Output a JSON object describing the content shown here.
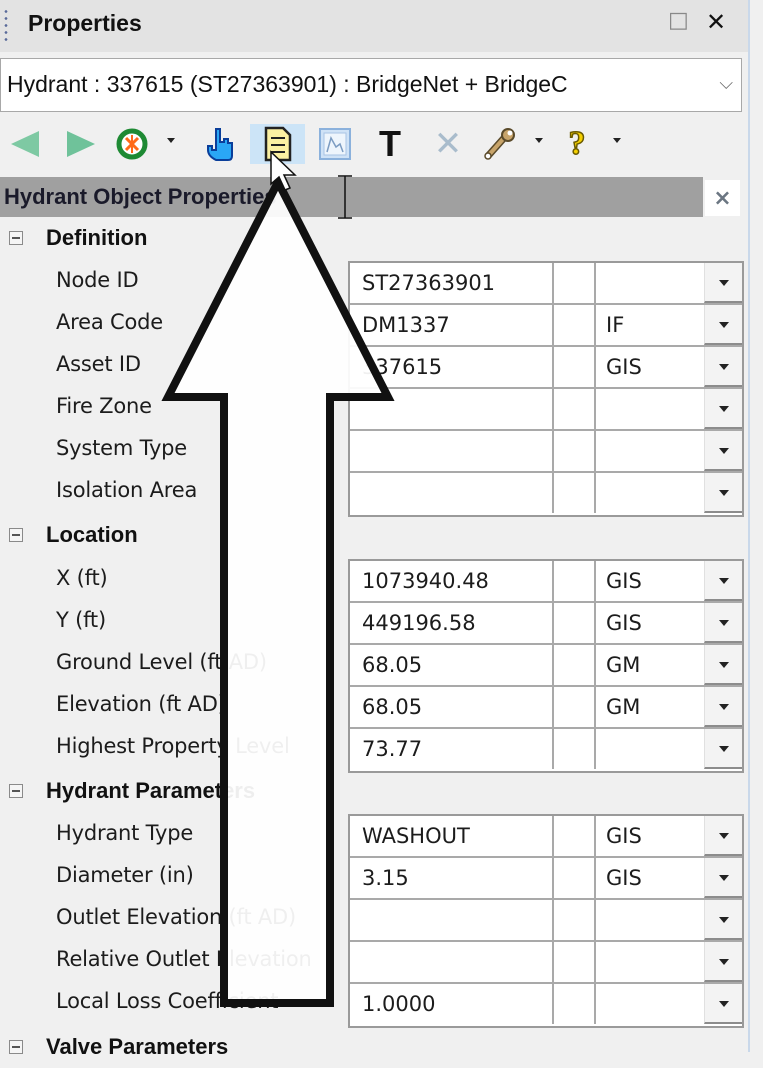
{
  "panel": {
    "title": "Properties",
    "restore_icon": "□",
    "close_icon": "✕"
  },
  "selector": {
    "value": "Hydrant : 337615 (ST27363901) : BridgeNet + BridgeC",
    "chevron": "⌵"
  },
  "toolbar": {
    "items": [
      {
        "name": "back",
        "icon": "back-arrow-icon"
      },
      {
        "name": "forward",
        "icon": "forward-arrow-icon"
      },
      {
        "name": "locate",
        "icon": "target-icon",
        "dropdown": true
      },
      {
        "name": "select",
        "icon": "pointing-hand-icon"
      },
      {
        "name": "properties",
        "icon": "notes-document-icon",
        "active": true
      },
      {
        "name": "graph",
        "icon": "graph-icon"
      },
      {
        "name": "text",
        "icon": "text-T-icon",
        "glyph": "T"
      },
      {
        "name": "delete",
        "icon": "delete-x-icon",
        "glyph": "✕"
      },
      {
        "name": "tools",
        "icon": "wrench-icon",
        "dropdown": true
      },
      {
        "name": "help",
        "icon": "help-question-icon",
        "glyph": "?",
        "dropdown": true
      }
    ]
  },
  "section": {
    "title": "Hydrant Object Properties",
    "close": "×"
  },
  "groups": [
    {
      "title": "Definition",
      "rows": [
        {
          "label": "Node ID",
          "value": "ST27363901",
          "source": ""
        },
        {
          "label": "Area Code",
          "value": "DM1337",
          "source": "IF"
        },
        {
          "label": "Asset ID",
          "value": "337615",
          "source": "GIS"
        },
        {
          "label": "Fire Zone",
          "value": "",
          "source": ""
        },
        {
          "label": "System Type",
          "value": "",
          "source": ""
        },
        {
          "label": "Isolation Area",
          "value": "",
          "source": ""
        }
      ]
    },
    {
      "title": "Location",
      "rows": [
        {
          "label": "X (ft)",
          "value": "1073940.48",
          "source": "GIS"
        },
        {
          "label": "Y (ft)",
          "value": "449196.58",
          "source": "GIS"
        },
        {
          "label": "Ground Level (ft AD)",
          "value": "68.05",
          "source": "GM"
        },
        {
          "label": "Elevation (ft AD)",
          "value": "68.05",
          "source": "GM"
        },
        {
          "label": "Highest Property Level",
          "value": "73.77",
          "source": ""
        }
      ]
    },
    {
      "title": "Hydrant Parameters",
      "rows": [
        {
          "label": "Hydrant Type",
          "value": "WASHOUT",
          "source": "GIS"
        },
        {
          "label": "Diameter (in)",
          "value": "3.15",
          "source": "GIS"
        },
        {
          "label": "Outlet Elevation (ft AD)",
          "value": "",
          "source": ""
        },
        {
          "label": "Relative Outlet Elevation",
          "value": "",
          "source": ""
        },
        {
          "label": "Local Loss Coefficient",
          "value": "1.0000",
          "source": ""
        }
      ]
    },
    {
      "title": "Valve Parameters",
      "rows": []
    }
  ],
  "annotation": {
    "type": "up-arrow-callout",
    "points_to": "properties"
  }
}
